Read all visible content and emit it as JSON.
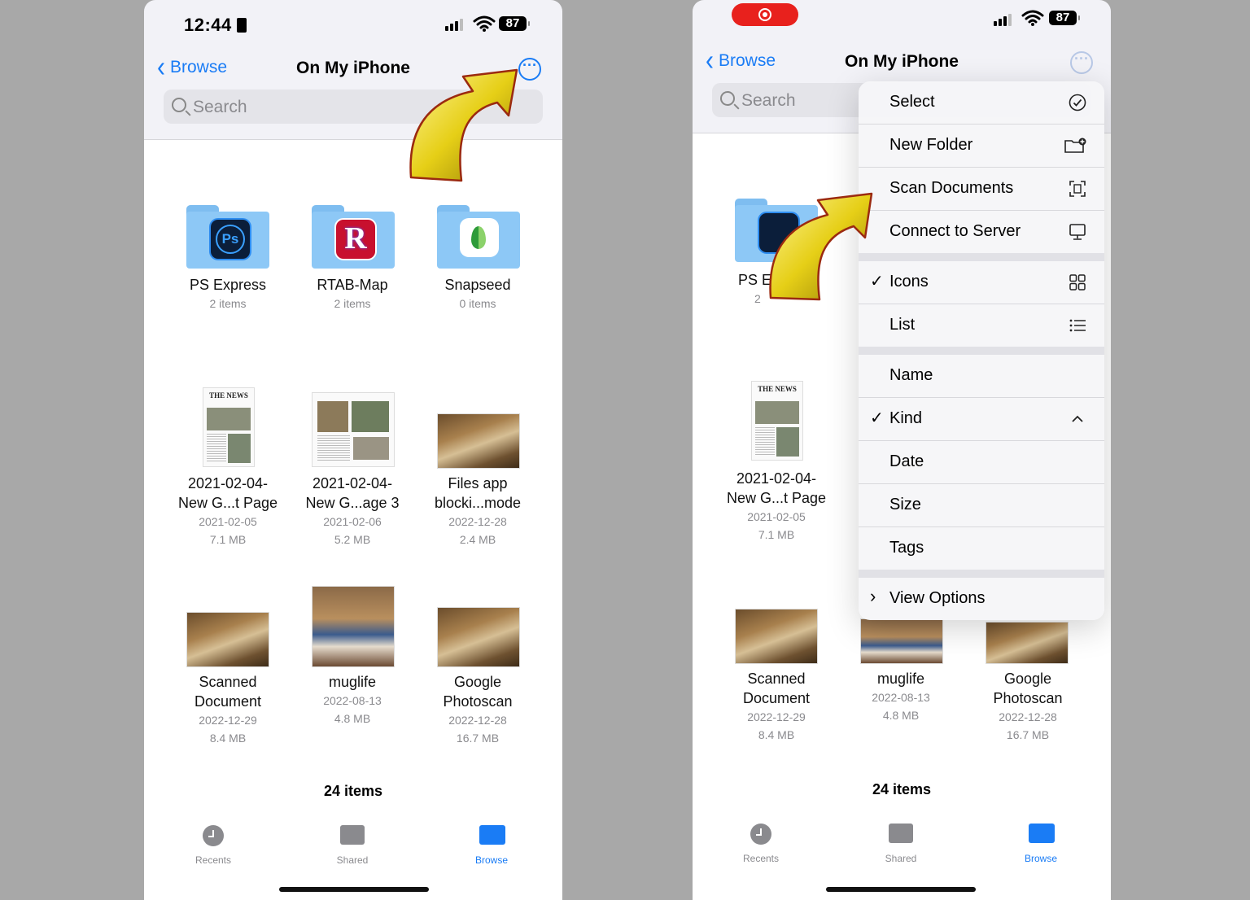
{
  "left": {
    "status": {
      "time": "12:44",
      "battery": "87"
    },
    "nav": {
      "back": "Browse",
      "title": "On My iPhone"
    },
    "search": {
      "placeholder": "Search"
    },
    "grid": [
      {
        "name": "PS Express",
        "meta1": "2 items",
        "meta2": ""
      },
      {
        "name": "RTAB-Map",
        "meta1": "2 items",
        "meta2": ""
      },
      {
        "name": "Snapseed",
        "meta1": "0 items",
        "meta2": ""
      },
      {
        "name": "2021-02-04-\nNew G...t Page",
        "meta1": "2021-02-05",
        "meta2": "7.1 MB"
      },
      {
        "name": "2021-02-04-\nNew G...age 3",
        "meta1": "2021-02-06",
        "meta2": "5.2 MB"
      },
      {
        "name": "Files app\nblocki...mode",
        "meta1": "2022-12-28",
        "meta2": "2.4 MB"
      },
      {
        "name": "Scanned\nDocument",
        "meta1": "2022-12-29",
        "meta2": "8.4 MB"
      },
      {
        "name": "muglife",
        "meta1": "2022-08-13",
        "meta2": "4.8 MB"
      },
      {
        "name": "Google\nPhotoscan",
        "meta1": "2022-12-28",
        "meta2": "16.7 MB"
      }
    ],
    "footer": "24 items",
    "tabs": [
      "Recents",
      "Shared",
      "Browse"
    ]
  },
  "right": {
    "status": {
      "battery": "87"
    },
    "nav": {
      "back": "Browse",
      "title": "On My iPhone"
    },
    "search": {
      "placeholder": "Search"
    },
    "grid_partial": {
      "name_fragment": "PS E",
      "meta_fragment": "2"
    },
    "grid": [
      {
        "name": "2021-02-04-\nNew G...t Page",
        "meta1": "2021-02-05",
        "meta2": "7.1 MB"
      },
      {
        "name": "Scanned\nDocument",
        "meta1": "2022-12-29",
        "meta2": "8.4 MB"
      },
      {
        "name": "muglife",
        "meta1": "2022-08-13",
        "meta2": "4.8 MB"
      },
      {
        "name": "Google\nPhotoscan",
        "meta1": "2022-12-28",
        "meta2": "16.7 MB"
      }
    ],
    "footer": "24 items",
    "tabs": [
      "Recents",
      "Shared",
      "Browse"
    ],
    "menu": {
      "section1": [
        "Select",
        "New Folder",
        "Scan Documents",
        "Connect to Server"
      ],
      "section2": [
        "Icons",
        "List"
      ],
      "section3": [
        "Name",
        "Kind",
        "Date",
        "Size",
        "Tags"
      ],
      "section4": [
        "View Options"
      ],
      "checked": [
        "Icons",
        "Kind"
      ]
    }
  },
  "colors": {
    "accent": "#1a7cf5",
    "arrow": "#e7d21c",
    "record": "#e8211d"
  }
}
